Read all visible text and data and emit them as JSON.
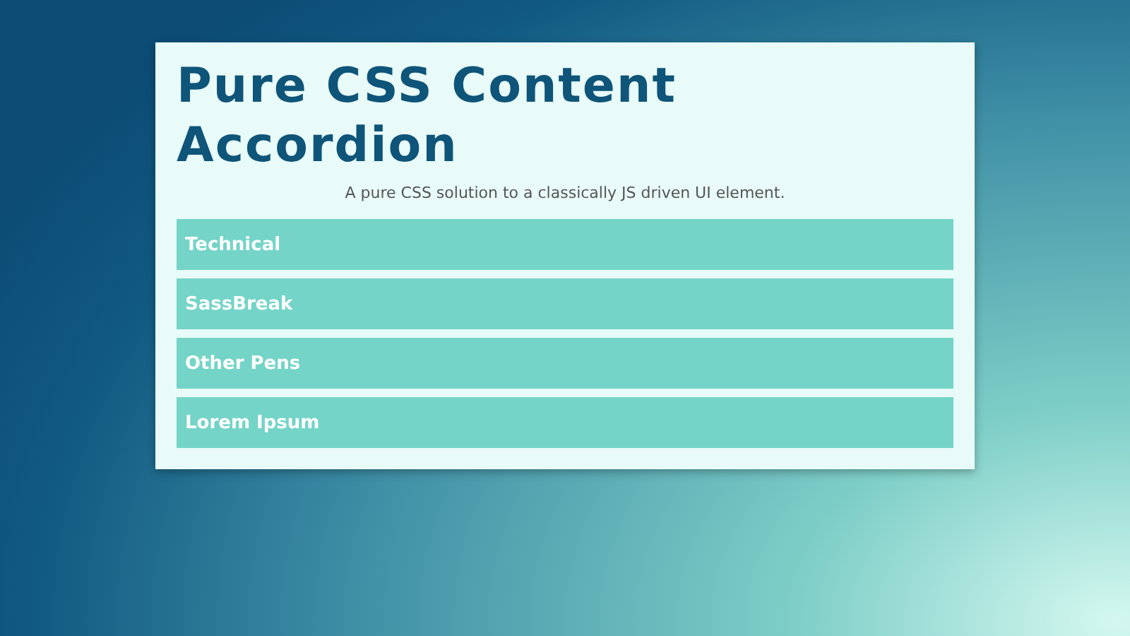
{
  "title": "Pure CSS Content Accordion",
  "subtitle": "A pure CSS solution to a classically JS driven UI element.",
  "sections": [
    {
      "label": "Technical"
    },
    {
      "label": "SassBreak"
    },
    {
      "label": "Other Pens"
    },
    {
      "label": "Lorem Ipsum"
    }
  ]
}
